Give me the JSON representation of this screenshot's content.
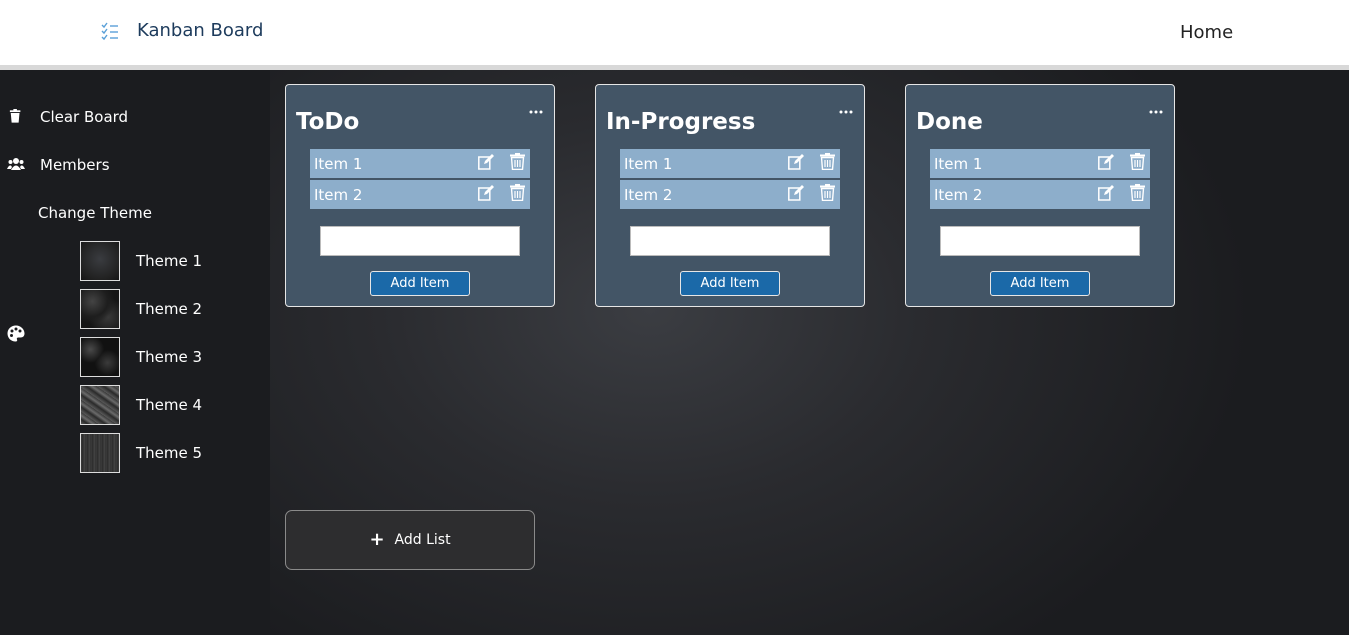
{
  "navbar": {
    "brand": "Kanban Board",
    "home": "Home"
  },
  "sidebar": {
    "clear_board": "Clear Board",
    "members": "Members",
    "change_theme": "Change Theme",
    "themes": [
      "Theme 1",
      "Theme 2",
      "Theme 3",
      "Theme 4",
      "Theme 5"
    ]
  },
  "lists": [
    {
      "title": "ToDo",
      "items": [
        "Item 1",
        "Item 2"
      ],
      "add_label": "Add Item"
    },
    {
      "title": "In-Progress",
      "items": [
        "Item 1",
        "Item 2"
      ],
      "add_label": "Add Item"
    },
    {
      "title": "Done",
      "items": [
        "Item 1",
        "Item 2"
      ],
      "add_label": "Add Item"
    }
  ],
  "add_list": {
    "icon": "+",
    "label": "Add List"
  },
  "colors": {
    "list_bg": "#435566",
    "item_bg": "#8daecb",
    "button": "#1b69a8",
    "brand": "#1d3b5c"
  }
}
